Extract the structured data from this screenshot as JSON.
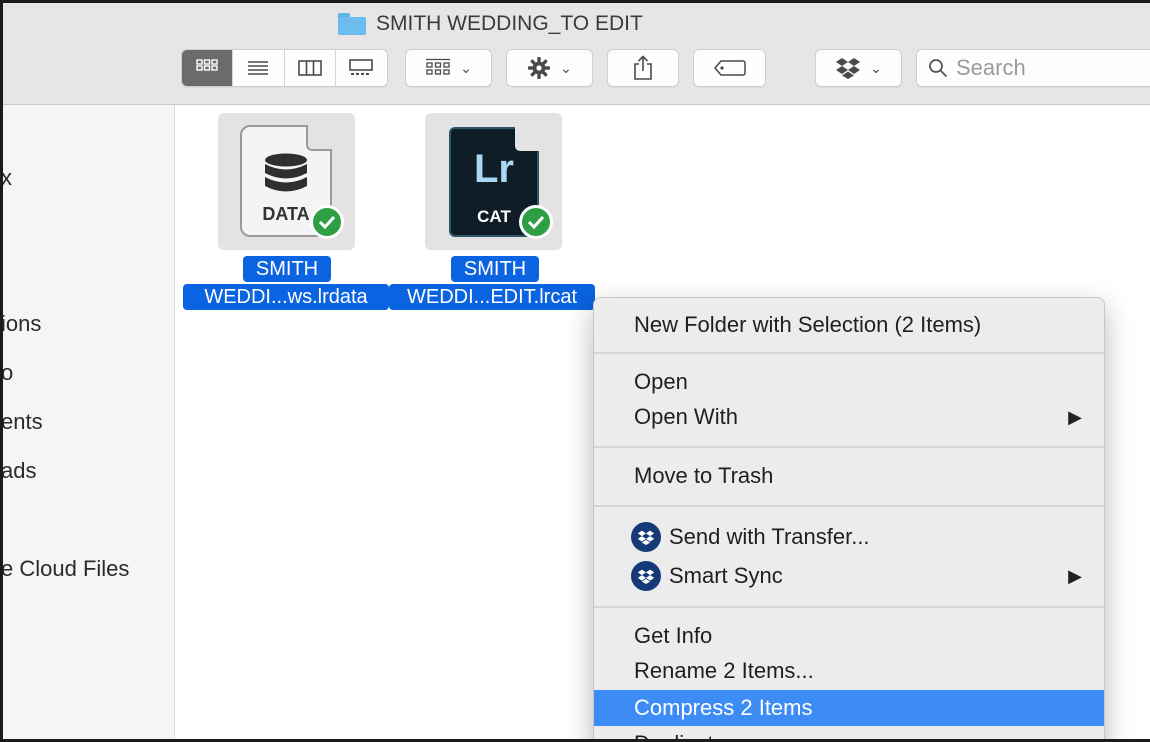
{
  "window": {
    "title": "SMITH WEDDING_TO EDIT"
  },
  "toolbar": {
    "view_modes": [
      "icon-view",
      "list-view",
      "column-view",
      "gallery-view"
    ],
    "active_view": "icon-view",
    "search_placeholder": "Search",
    "dropdown_chevron": "⌄"
  },
  "sidebar": {
    "items": [
      {
        "label": "x"
      },
      {
        "label": "ions"
      },
      {
        "label": "o"
      },
      {
        "label": "ents"
      },
      {
        "label": "ads"
      },
      {
        "label": "e Cloud Files"
      }
    ]
  },
  "files": [
    {
      "type_label": "DATA",
      "name_line1": "SMITH",
      "name_line2": "WEDDI...ws.lrdata",
      "sync_status": "synced"
    },
    {
      "type_label": "CAT",
      "glyph": "Lr",
      "name_line1": "SMITH",
      "name_line2": "WEDDI...EDIT.lrcat",
      "sync_status": "synced"
    }
  ],
  "context_menu": {
    "items": [
      {
        "label": "New Folder with Selection (2 Items)"
      },
      {
        "label": "Open"
      },
      {
        "label": "Open With",
        "submenu": "▶"
      },
      {
        "label": "Move to Trash"
      },
      {
        "label": "Send with Transfer...",
        "icon": "dropbox-icon"
      },
      {
        "label": "Smart Sync",
        "icon": "dropbox-icon",
        "submenu": "▶"
      },
      {
        "label": "Get Info"
      },
      {
        "label": "Rename 2 Items..."
      },
      {
        "label": "Compress 2 Items",
        "highlighted": true
      },
      {
        "label": "Duplicate"
      }
    ]
  },
  "colors": {
    "selection_blue": "#0a63e0",
    "menu_highlight": "#3d8cf5",
    "sync_green": "#2ea043",
    "dropbox_navy": "#153a77",
    "folder_blue": "#6cbcf0"
  }
}
